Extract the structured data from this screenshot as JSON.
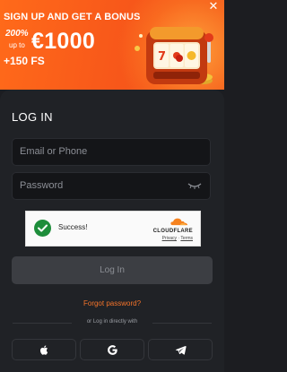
{
  "banner": {
    "headline": "SIGN UP AND GET A BONUS",
    "percent": "200%",
    "up_to": "up to",
    "amount": "€1000",
    "free_spins": "+150 FS",
    "close_icon": "close-icon",
    "colors": {
      "primary": "#f7571a",
      "accent": "#ff9f3a"
    }
  },
  "login": {
    "title": "LOG IN",
    "email_placeholder": "Email or Phone",
    "password_placeholder": "Password",
    "eye_icon": "eye-closed-icon",
    "captcha": {
      "status": "Success!",
      "brand": "CLOUDFLARE",
      "privacy": "Privacy",
      "separator": "·",
      "terms": "Terms"
    },
    "submit_label": "Log In",
    "forgot_label": "Forgot password?",
    "divider_text": "or Log in directly with",
    "social": [
      {
        "name": "apple",
        "icon": "apple-icon"
      },
      {
        "name": "google",
        "icon": "google-icon"
      },
      {
        "name": "telegram",
        "icon": "telegram-icon"
      }
    ],
    "colors": {
      "accent": "#f5742a",
      "card": "#202226",
      "success": "#1d8d3a"
    }
  }
}
